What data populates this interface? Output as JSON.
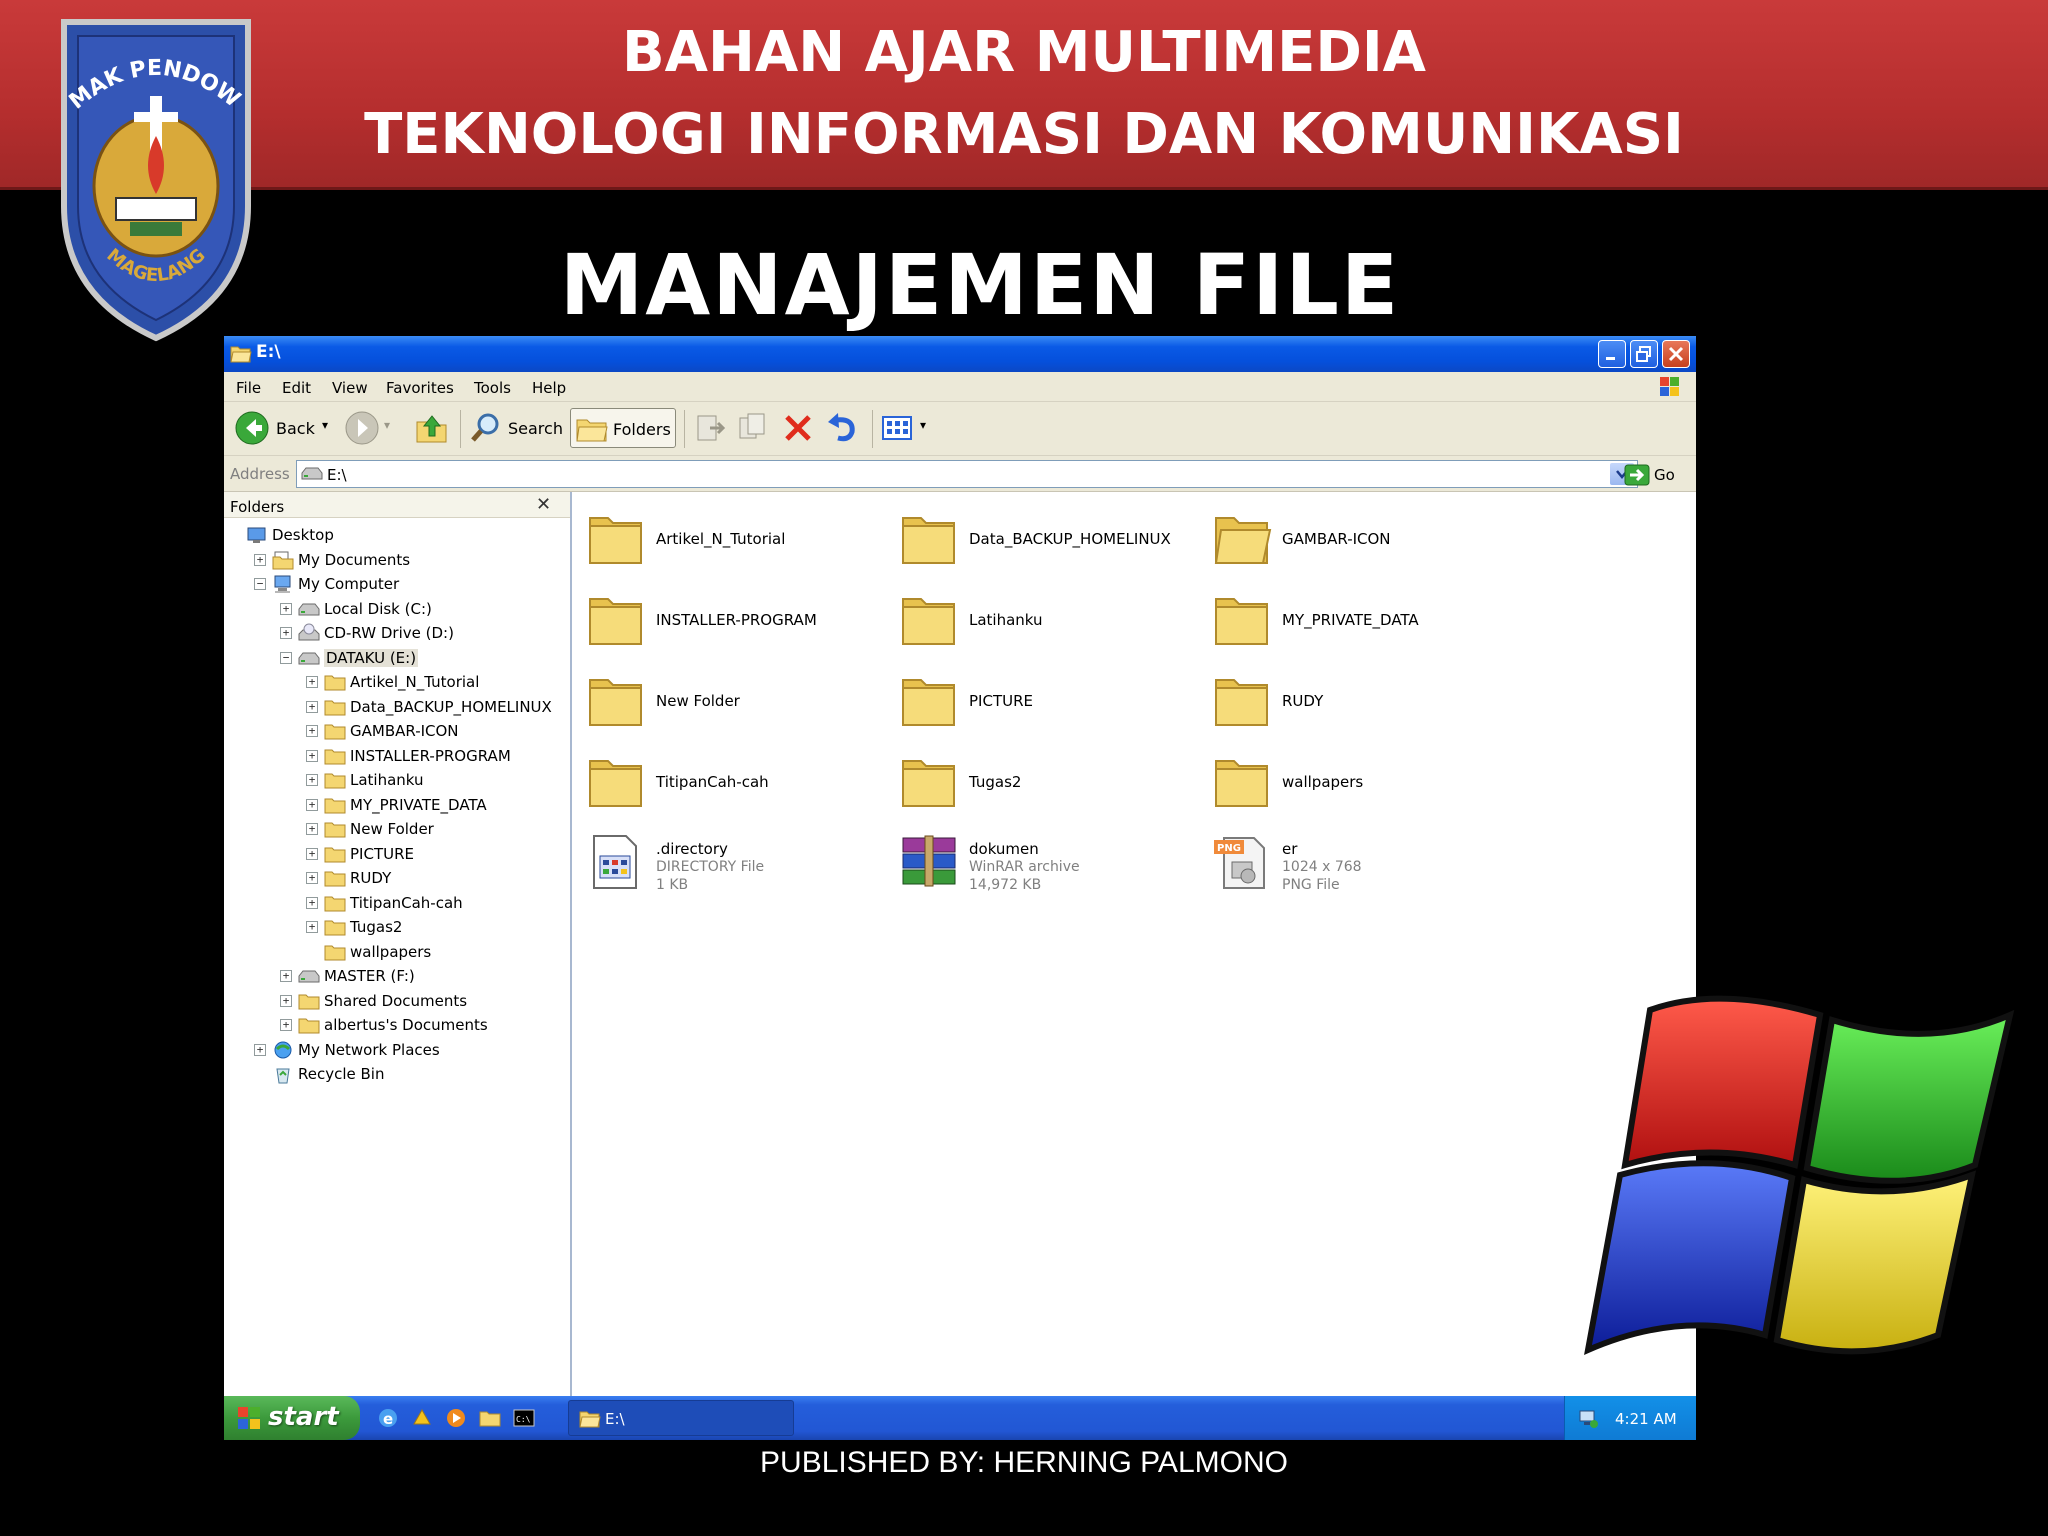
{
  "slide": {
    "banner_line1": "BAHAN AJAR MULTIMEDIA",
    "banner_line2": "TEKNOLOGI INFORMASI DAN KOMUNIKASI",
    "title": "MANAJEMEN FILE",
    "footer": "PUBLISHED BY: HERNING PALMONO",
    "logo_top_text": "SMAK PENDOWO",
    "logo_bottom_text": "MAGELANG"
  },
  "window": {
    "title": "E:\\",
    "menu": [
      "File",
      "Edit",
      "View",
      "Favorites",
      "Tools",
      "Help"
    ],
    "toolbar": {
      "back": "Back",
      "search": "Search",
      "folders": "Folders"
    },
    "address": {
      "label": "Address",
      "value": "E:\\",
      "go": "Go"
    }
  },
  "folders_pane": {
    "title": "Folders",
    "tree": [
      {
        "label": "Desktop",
        "icon": "desktop-icon",
        "expander": ""
      },
      {
        "label": "My Documents",
        "icon": "my-documents-icon",
        "expander": "+"
      },
      {
        "label": "My Computer",
        "icon": "my-computer-icon",
        "expander": "−"
      },
      {
        "label": "Local Disk (C:)",
        "icon": "hard-drive-icon",
        "expander": "+"
      },
      {
        "label": "CD-RW Drive (D:)",
        "icon": "cd-drive-icon",
        "expander": "+"
      },
      {
        "label": "DATAKU (E:)",
        "icon": "hard-drive-icon",
        "expander": "−"
      },
      {
        "label": "Artikel_N_Tutorial",
        "icon": "folder-icon",
        "expander": "+"
      },
      {
        "label": "Data_BACKUP_HOMELINUX",
        "icon": "folder-icon",
        "expander": "+"
      },
      {
        "label": "GAMBAR-ICON",
        "icon": "folder-icon",
        "expander": "+"
      },
      {
        "label": "INSTALLER-PROGRAM",
        "icon": "folder-icon",
        "expander": "+"
      },
      {
        "label": "Latihanku",
        "icon": "folder-icon",
        "expander": "+"
      },
      {
        "label": "MY_PRIVATE_DATA",
        "icon": "folder-icon",
        "expander": "+"
      },
      {
        "label": "New Folder",
        "icon": "folder-icon",
        "expander": "+"
      },
      {
        "label": "PICTURE",
        "icon": "folder-icon",
        "expander": "+"
      },
      {
        "label": "RUDY",
        "icon": "folder-icon",
        "expander": "+"
      },
      {
        "label": "TitipanCah-cah",
        "icon": "folder-icon",
        "expander": "+"
      },
      {
        "label": "Tugas2",
        "icon": "folder-icon",
        "expander": "+"
      },
      {
        "label": "wallpapers",
        "icon": "folder-icon",
        "expander": ""
      },
      {
        "label": "MASTER (F:)",
        "icon": "hard-drive-icon",
        "expander": "+"
      },
      {
        "label": "Shared Documents",
        "icon": "folder-icon",
        "expander": "+"
      },
      {
        "label": "albertus's Documents",
        "icon": "folder-icon",
        "expander": "+"
      },
      {
        "label": "My Network Places",
        "icon": "network-places-icon",
        "expander": "+"
      },
      {
        "label": "Recycle Bin",
        "icon": "recycle-bin-icon",
        "expander": ""
      }
    ]
  },
  "content": {
    "items": [
      {
        "name": "Artikel_N_Tutorial",
        "icon": "folder-icon"
      },
      {
        "name": "Data_BACKUP_HOMELINUX",
        "icon": "folder-icon"
      },
      {
        "name": "GAMBAR-ICON",
        "icon": "folder-open-icon"
      },
      {
        "name": "INSTALLER-PROGRAM",
        "icon": "folder-icon"
      },
      {
        "name": "Latihanku",
        "icon": "folder-icon"
      },
      {
        "name": "MY_PRIVATE_DATA",
        "icon": "folder-icon"
      },
      {
        "name": "New Folder",
        "icon": "folder-icon"
      },
      {
        "name": "PICTURE",
        "icon": "folder-icon"
      },
      {
        "name": "RUDY",
        "icon": "folder-icon"
      },
      {
        "name": "TitipanCah-cah",
        "icon": "folder-icon"
      },
      {
        "name": "Tugas2",
        "icon": "folder-icon"
      },
      {
        "name": "wallpapers",
        "icon": "folder-icon"
      },
      {
        "name": ".directory",
        "icon": "directory-file-icon",
        "type": "DIRECTORY File",
        "detail": "1 KB"
      },
      {
        "name": "dokumen",
        "icon": "winrar-archive-icon",
        "type": "WinRAR archive",
        "detail": "14,972 KB"
      },
      {
        "name": "er",
        "icon": "png-file-icon",
        "type": "1024 x 768",
        "detail": "PNG File"
      }
    ]
  },
  "taskbar": {
    "start": "start",
    "task": "E:\\",
    "clock": "4:21 AM"
  },
  "colors": {
    "banner_red": "#c93a3a",
    "xp_blue": "#0550dc",
    "start_green": "#3c9a3c",
    "folder_yellow": "#f4d671"
  }
}
